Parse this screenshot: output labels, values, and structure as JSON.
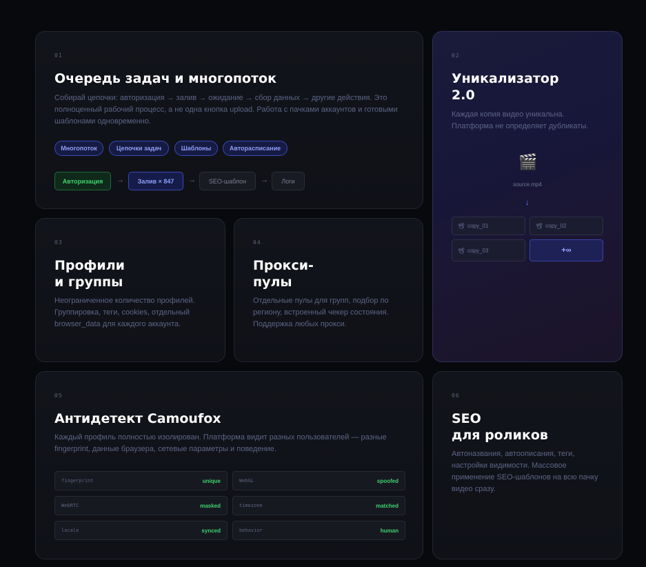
{
  "cards": {
    "queue": {
      "num": "01",
      "title": "Очередь задач и многопоток",
      "desc": "Собирай цепочки: авторизация → залив → ожидание → сбор данных → другие действия. Это полноценный рабочий процесс, а не одна кнопка upload. Работа с пачками аккаунтов и готовыми шаблонами одновременно.",
      "chips": [
        "Многопоток",
        "Цепочки задач",
        "Шаблоны",
        "Авторасписание"
      ],
      "pipeline": [
        "Авторизация",
        "Залив × 847",
        "SEO-шаблон",
        "Логи"
      ],
      "arrow": "→"
    },
    "uniq": {
      "num": "02",
      "title_line1": "Уникализатор",
      "title_line2": "2.0",
      "desc": "Каждая копия видео уникальна. Платформа не определяет дубликаты.",
      "file_icon": "🎬",
      "file_name": "source.mp4",
      "down_arrow": "↓",
      "copy_icon": "📽",
      "copies": [
        "copy_01",
        "copy_02",
        "copy_03"
      ],
      "more": "+∞"
    },
    "profiles": {
      "num": "03",
      "title_line1": "Профили",
      "title_line2": "и группы",
      "desc": "Неограниченное количество профилей. Группировка, теги, cookies, отдельный browser_data для каждого аккаунта."
    },
    "proxy": {
      "num": "04",
      "title_line1": "Прокси-",
      "title_line2": "пулы",
      "desc": "Отдельные пулы для групп, подбор по региону, встроенный чекер состояния. Поддержка любых прокси."
    },
    "antidetect": {
      "num": "05",
      "title": "Антидетект Camoufox",
      "desc": "Каждый профиль полностью изолирован. Платформа видит разных пользователей — разные fingerprint, данные браузера, сетевые параметры и поведение.",
      "params": [
        {
          "key": "fingerprint",
          "value": "unique"
        },
        {
          "key": "WebGL",
          "value": "spoofed"
        },
        {
          "key": "WebRTC",
          "value": "masked"
        },
        {
          "key": "timezone",
          "value": "matched"
        },
        {
          "key": "locale",
          "value": "synced"
        },
        {
          "key": "behavior",
          "value": "human"
        }
      ]
    },
    "seo": {
      "num": "06",
      "title_line1": "SEO",
      "title_line2": "для роликов",
      "desc": "Автоназвания, автоописания, теги, настройки видимости. Массовое применение SEO-шаблонов на всю пачку видео сразу."
    }
  },
  "colors": {
    "background": "#08090d",
    "card": "#12141b",
    "accent_blue": "#8e9ef6",
    "accent_green": "#3fd26d",
    "uniq_bg": "#1a1b3a"
  }
}
